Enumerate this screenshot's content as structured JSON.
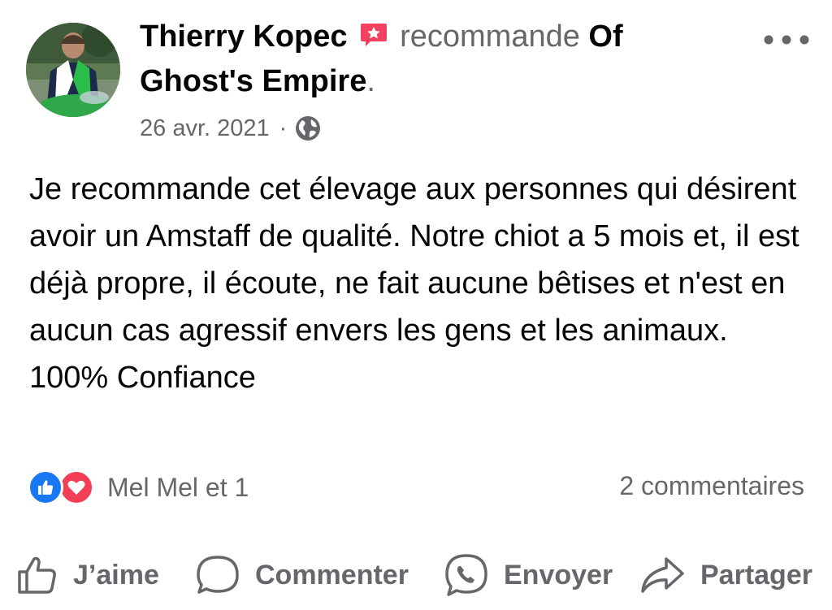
{
  "header": {
    "author": "Thierry Kopec",
    "verb": "recommande",
    "page_name": "Of Ghost's Empire",
    "period": ".",
    "date": "26 avr. 2021",
    "separator": "·",
    "privacy_icon": "globe-icon",
    "recommend_icon": "recommend-flag-icon",
    "more_icon": "more-horizontal-icon"
  },
  "post": {
    "text": "Je recommande cet élevage aux personnes qui désirent avoir un Amstaff de qualité. Notre chiot a 5 mois et, il est déjà propre, il écoute, ne fait aucune bêtises et n'est en aucun cas agressif envers les gens et les animaux. 100% Confiance"
  },
  "reactions": {
    "types": [
      "like-icon",
      "love-icon"
    ],
    "summary": "Mel Mel et 1",
    "comments": "2 commentaires"
  },
  "actions": [
    {
      "label": "J’aime",
      "icon": "thumbs-up-icon"
    },
    {
      "label": "Commenter",
      "icon": "comment-bubble-icon"
    },
    {
      "label": "Envoyer",
      "icon": "messenger-icon"
    },
    {
      "label": "Partager",
      "icon": "share-arrow-icon"
    }
  ],
  "colors": {
    "text": "#050505",
    "secondary": "#65676b",
    "like_blue": "#1877f2",
    "love_red": "#f33e58",
    "recommend_red": "#f3425f"
  }
}
